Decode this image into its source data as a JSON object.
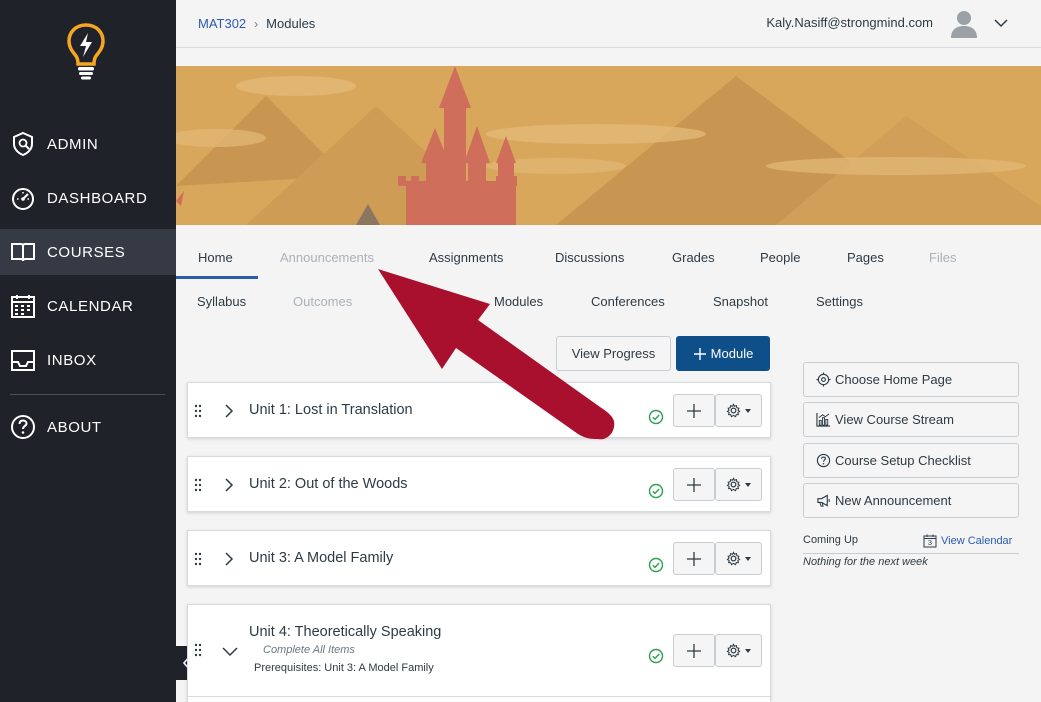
{
  "nav": {
    "items": [
      {
        "label": "ADMIN",
        "icon": "shield-icon"
      },
      {
        "label": "DASHBOARD",
        "icon": "speedometer-icon"
      },
      {
        "label": "COURSES",
        "icon": "book-icon"
      },
      {
        "label": "CALENDAR",
        "icon": "calendar-icon"
      },
      {
        "label": "INBOX",
        "icon": "inbox-icon"
      },
      {
        "label": "ABOUT",
        "icon": "help-circle-icon"
      }
    ],
    "active": "COURSES"
  },
  "header": {
    "course_link": "MAT302",
    "current": "Modules",
    "user_email": "Kaly.Nasiff@strongmind.com"
  },
  "tabs": {
    "row1": [
      "Home",
      "Announcements",
      "Assignments",
      "Discussions",
      "Grades",
      "People",
      "Pages",
      "Files"
    ],
    "row2": [
      "Syllabus",
      "Outcomes",
      "C",
      "Modules",
      "Conferences",
      "Snapshot",
      "Settings"
    ],
    "active": "Home",
    "disabled": [
      "Announcements",
      "Files",
      "Outcomes"
    ]
  },
  "actions": {
    "view_progress": "View Progress",
    "add_module": "Module"
  },
  "modules": [
    {
      "title": "Unit 1: Lost in Translation",
      "expanded": false
    },
    {
      "title": "Unit 2: Out of the Woods",
      "expanded": false
    },
    {
      "title": "Unit 3: A Model Family",
      "expanded": false
    },
    {
      "title": "Unit 4: Theoretically Speaking",
      "expanded": true,
      "requirement": "Complete All Items",
      "prerequisites": "Prerequisites: Unit 3: A Model Family"
    }
  ],
  "sidebar": {
    "buttons": [
      {
        "label": "Choose Home Page",
        "icon": "target-icon"
      },
      {
        "label": "View Course Stream",
        "icon": "chart-icon"
      },
      {
        "label": "Course Setup Checklist",
        "icon": "question-icon"
      },
      {
        "label": "New Announcement",
        "icon": "megaphone-icon"
      }
    ],
    "coming_up": "Coming Up",
    "view_calendar": "View Calendar",
    "calendar_day": "3",
    "nothing": "Nothing for the next week"
  },
  "colors": {
    "nav_bg": "#1f2229",
    "accent": "#2b5bab",
    "primary_button": "#0e4f8a",
    "success": "#2e9e4f",
    "arrow": "#a8102e",
    "logo": "#f5a623"
  }
}
